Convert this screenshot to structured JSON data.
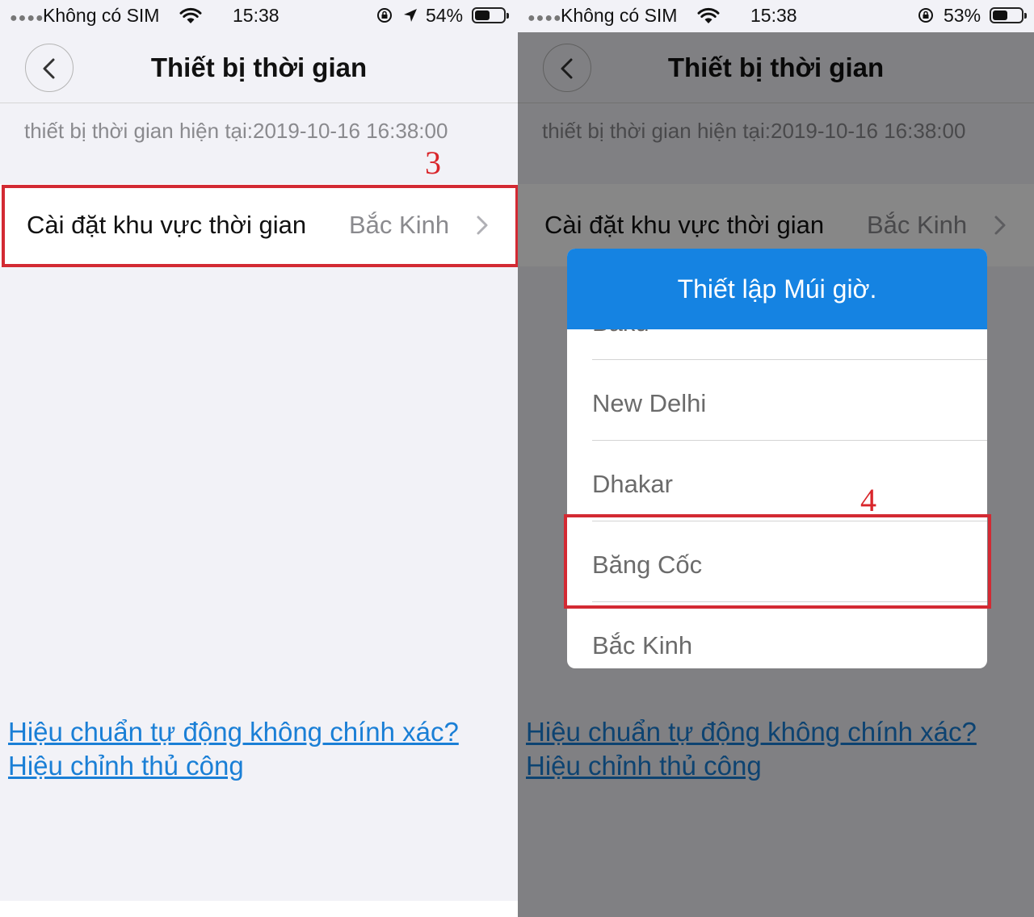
{
  "left_screen": {
    "status": {
      "carrier": "Không có SIM",
      "time": "15:38",
      "battery": "54%",
      "battery_level": 0.54
    },
    "nav": {
      "title": "Thiết bị thời gian"
    },
    "current_time": "thiết bị thời gian hiện tại:2019-10-16 16:38:00",
    "timezone_row": {
      "label": "Cài đặt khu vực thời gian",
      "value": "Bắc Kinh"
    },
    "manual_link": {
      "line1": "Hiệu chuẩn tự động không chính xác?",
      "line2": "Hiệu chỉnh thủ công"
    },
    "step_marker": "3"
  },
  "right_screen": {
    "status": {
      "carrier": "Không có SIM",
      "time": "15:38",
      "battery": "53%",
      "battery_level": 0.53
    },
    "nav": {
      "title": "Thiết bị thời gian"
    },
    "current_time": "thiết bị thời gian hiện tại:2019-10-16 16:38:00",
    "timezone_row": {
      "label": "Cài đặt khu vực thời gian",
      "value": "Bắc Kinh"
    },
    "manual_link": {
      "line1": "Hiệu chuẩn tự động không chính xác?",
      "line2": "Hiệu chỉnh thủ công"
    },
    "modal": {
      "title": "Thiết lập Múi giờ.",
      "options": [
        "Baku",
        "New Delhi",
        "Dhakar",
        "Băng Cốc",
        "Bắc Kinh"
      ]
    },
    "step_marker": "4"
  },
  "colors": {
    "accent": "#1583e2",
    "link": "#1a7fd6",
    "highlight": "#d32a33",
    "step_number": "#d9262b"
  },
  "icons": [
    "signal-dots-icon",
    "wifi-icon",
    "rotation-lock-icon",
    "location-arrow-icon",
    "battery-icon",
    "back-chevron-icon",
    "chevron-right-icon"
  ]
}
